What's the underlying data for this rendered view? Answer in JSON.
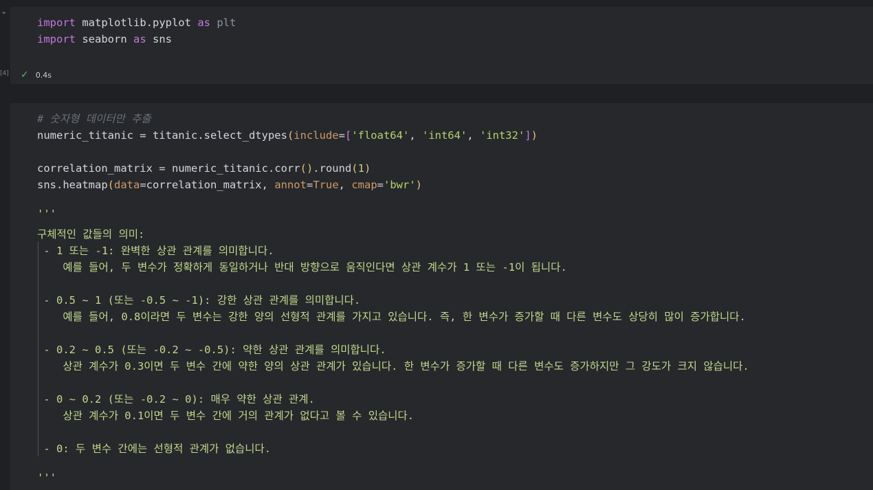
{
  "cell1": {
    "line1": {
      "kw1": "import",
      "mod": " matplotlib.pyplot ",
      "kw2": "as",
      "alias": " plt"
    },
    "line2": {
      "kw1": "import",
      "mod": " seaborn ",
      "kw2": "as",
      "alias": " sns"
    },
    "exec_label": "[4]",
    "status_time": "0.4s"
  },
  "cell2": {
    "comment": "# 숫자형 데이터만 추출",
    "line_select": {
      "a": "numeric_titanic = titanic.select_dtypes",
      "p1": "(",
      "b": "include",
      "eq": "=",
      "br1": "[",
      "s1": "'float64'",
      "c1": ", ",
      "s2": "'int64'",
      "c2": ", ",
      "s3": "'int32'",
      "br2": "]",
      "p2": ")"
    },
    "line_corr": {
      "a": "correlation_matrix = numeric_titanic.corr",
      "p": "()",
      "b": ".round",
      "p1": "(",
      "n": "1",
      "p2": ")"
    },
    "line_heat": {
      "a": "sns.heatmap",
      "p1": "(",
      "k1": "data",
      "eq1": "=",
      "v1": "correlation_matrix, ",
      "k2": "annot",
      "eq2": "=",
      "v2": "True",
      "c": ", ",
      "k3": "cmap",
      "eq3": "=",
      "v3": "'bwr'",
      "p2": ")"
    },
    "doc_open": "'''",
    "doc_title": "구체적인 값들의 의미:",
    "doc_lines": [
      " - 1 또는 -1: 완벽한 상관 관계를 의미합니다.",
      "    예를 들어, 두 변수가 정확하게 동일하거나 반대 방향으로 움직인다면 상관 계수가 1 또는 -1이 됩니다.",
      "",
      " - 0.5 ~ 1 (또는 -0.5 ~ -1): 강한 상관 관계를 의미합니다.",
      "    예를 들어, 0.8이라면 두 변수는 강한 양의 선형적 관계를 가지고 있습니다. 즉, 한 변수가 증가할 때 다른 변수도 상당히 많이 증가합니다.",
      "",
      " - 0.2 ~ 0.5 (또는 -0.2 ~ -0.5): 약한 상관 관계를 의미합니다.",
      "    상관 계수가 0.3이면 두 변수 간에 약한 양의 상관 관계가 있습니다. 한 변수가 증가할 때 다른 변수도 증가하지만 그 강도가 크지 않습니다.",
      "",
      " - 0 ~ 0.2 (또는 -0.2 ~ 0): 매우 약한 상관 관계.",
      "    상관 계수가 0.1이면 두 변수 간에 거의 관계가 없다고 볼 수 있습니다.",
      "",
      " - 0: 두 변수 간에는 선형적 관계가 없습니다."
    ],
    "doc_close": "'''"
  },
  "colors": {
    "keyword": "#c678dd",
    "string": "#b7d36a",
    "bracket": "#e5c07b",
    "param": "#d19a66",
    "comment": "#6b7079",
    "success": "#63b56b"
  },
  "icons": {
    "collapse": "chevron-down-icon",
    "status": "check-icon"
  }
}
